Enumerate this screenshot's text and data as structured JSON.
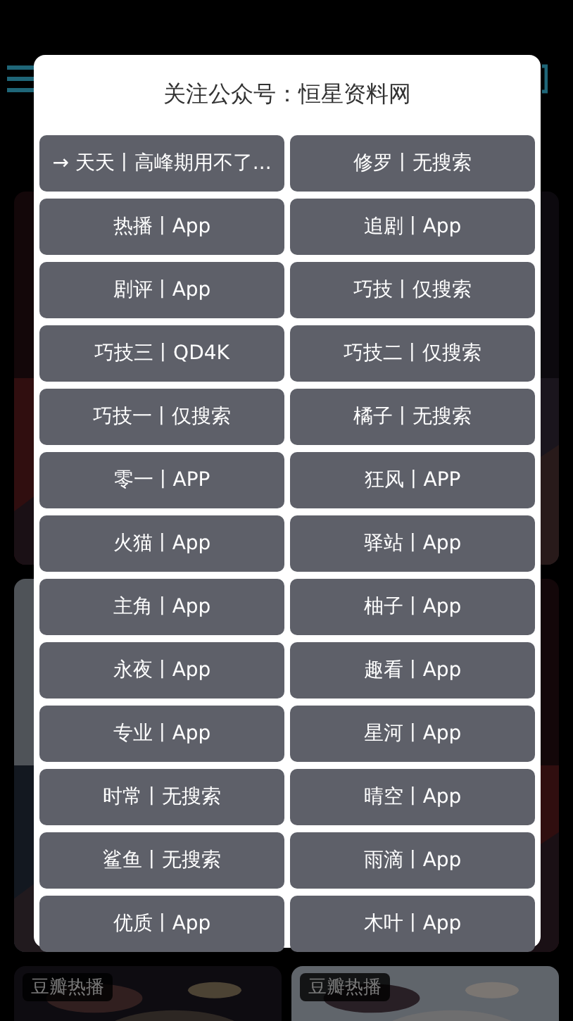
{
  "background": {
    "cards": [
      {
        "kind": "picture"
      },
      {
        "kind": "picture"
      },
      {
        "kind": "picture"
      },
      {
        "kind": "picture"
      },
      {
        "kind": "picture",
        "badge": "豆瓣热播"
      },
      {
        "kind": "picture",
        "badge": "豆瓣热播"
      }
    ]
  },
  "dialog": {
    "title": "关注公众号：恒星资料网",
    "sources": [
      "→ 天天丨高峰期用不了...",
      "修罗丨无搜索",
      "热播丨App",
      "追剧丨App",
      "剧评丨App",
      "巧技丨仅搜索",
      "巧技三丨QD4K",
      "巧技二丨仅搜索",
      "巧技一丨仅搜索",
      "橘子丨无搜索",
      "零一丨APP",
      "狂风丨APP",
      "火猫丨App",
      "驿站丨App",
      "主角丨App",
      "柚子丨App",
      "永夜丨App",
      "趣看丨App",
      "专业丨App",
      "星河丨App",
      "时常丨无搜索",
      "晴空丨App",
      "鲨鱼丨无搜索",
      "雨滴丨App",
      "优质丨App",
      "木叶丨App"
    ]
  }
}
